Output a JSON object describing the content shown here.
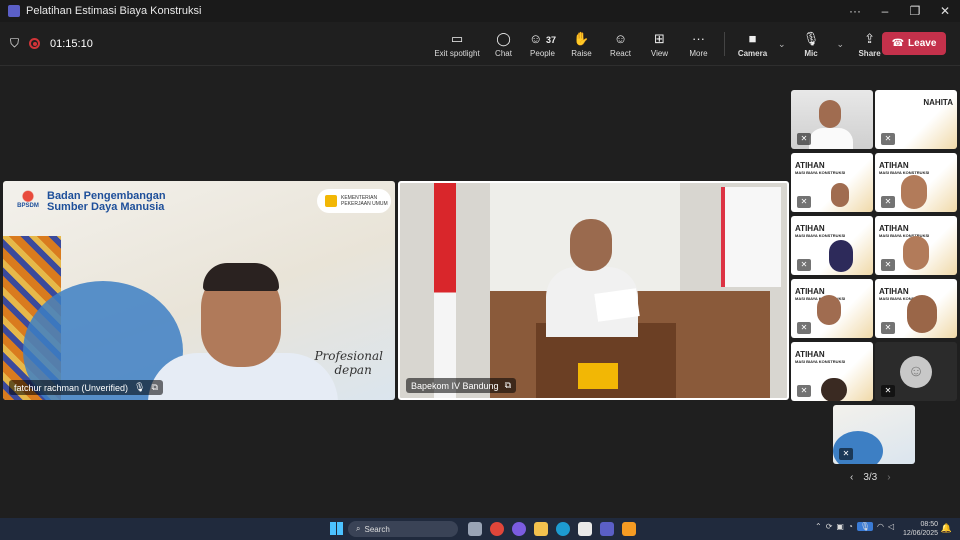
{
  "window": {
    "title": "Pelatihan Estimasi Biaya Konstruksi"
  },
  "meeting": {
    "timer": "01:15:10",
    "toolbar": [
      {
        "icon": "exit-spotlight-icon",
        "label": "Exit spotlight"
      },
      {
        "icon": "chat-icon",
        "label": "Chat"
      },
      {
        "icon": "people-icon",
        "label": "People",
        "count": "37"
      },
      {
        "icon": "raise-hand-icon",
        "label": "Raise"
      },
      {
        "icon": "react-icon",
        "label": "React"
      },
      {
        "icon": "view-icon",
        "label": "View"
      },
      {
        "icon": "more-icon",
        "label": "More"
      }
    ],
    "av": {
      "camera": "Camera",
      "mic": "Mic",
      "share": "Share"
    },
    "leave_label": "Leave"
  },
  "main_tiles": [
    {
      "name": "fatchur rachman (Unverified)",
      "bg_title_1": "Badan Pengembangan",
      "bg_title_2": "Sumber Daya Manusia",
      "bg_logo": "BPSDM",
      "bg_badge_1": "KEMENTERIAN",
      "bg_badge_2": "PEKERJAAN UMUM",
      "bg_slogan_1": "Profesional",
      "bg_slogan_2": "depan"
    },
    {
      "name": "Bapekom IV Bandung"
    }
  ],
  "gallery": {
    "slide_text": "ATIHAN",
    "slide_sub": "MASI BIAYA KONSTRUKSI",
    "slide_alt": "NAHITA",
    "pager": "3/3"
  },
  "taskbar": {
    "search_placeholder": "Search",
    "time": "08:50",
    "date": "12/06/2025"
  },
  "colors": {
    "accent": "#5b5fc7",
    "leave": "#c4314b",
    "taskbar": "#202a3d"
  }
}
